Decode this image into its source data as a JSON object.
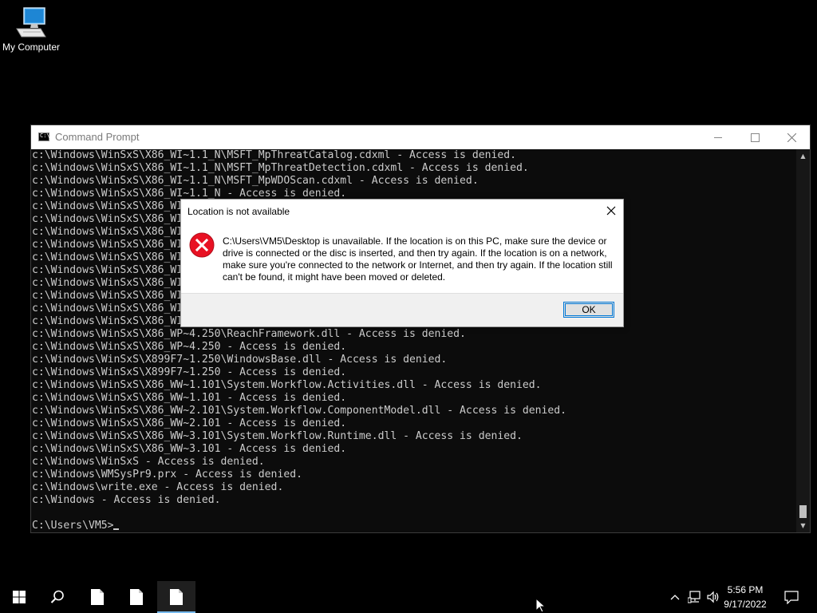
{
  "desktop": {
    "icon_label": "My Computer"
  },
  "cmd": {
    "title": "Command Prompt",
    "lines": [
      "c:\\Windows\\WinSxS\\X86_WI~1.1_N\\MSFT_MpThreatCatalog.cdxml - Access is denied.",
      "c:\\Windows\\WinSxS\\X86_WI~1.1_N\\MSFT_MpThreatDetection.cdxml - Access is denied.",
      "c:\\Windows\\WinSxS\\X86_WI~1.1_N\\MSFT_MpWDOScan.cdxml - Access is denied.",
      "c:\\Windows\\WinSxS\\X86_WI~1.1_N - Access is denied.",
      "c:\\Windows\\WinSxS\\X86_WI",
      "c:\\Windows\\WinSxS\\X86_WI",
      "c:\\Windows\\WinSxS\\X86_WI",
      "c:\\Windows\\WinSxS\\X86_WI",
      "c:\\Windows\\WinSxS\\X86_WI",
      "c:\\Windows\\WinSxS\\X86_WI",
      "c:\\Windows\\WinSxS\\X86_WI",
      "c:\\Windows\\WinSxS\\X86_WI",
      "c:\\Windows\\WinSxS\\X86_WI",
      "c:\\Windows\\WinSxS\\X86_WI",
      "c:\\Windows\\WinSxS\\X86_WP~4.250\\ReachFramework.dll - Access is denied.",
      "c:\\Windows\\WinSxS\\X86_WP~4.250 - Access is denied.",
      "c:\\Windows\\WinSxS\\X899F7~1.250\\WindowsBase.dll - Access is denied.",
      "c:\\Windows\\WinSxS\\X899F7~1.250 - Access is denied.",
      "c:\\Windows\\WinSxS\\X86_WW~1.101\\System.Workflow.Activities.dll - Access is denied.",
      "c:\\Windows\\WinSxS\\X86_WW~1.101 - Access is denied.",
      "c:\\Windows\\WinSxS\\X86_WW~2.101\\System.Workflow.ComponentModel.dll - Access is denied.",
      "c:\\Windows\\WinSxS\\X86_WW~2.101 - Access is denied.",
      "c:\\Windows\\WinSxS\\X86_WW~3.101\\System.Workflow.Runtime.dll - Access is denied.",
      "c:\\Windows\\WinSxS\\X86_WW~3.101 - Access is denied.",
      "c:\\Windows\\WinSxS - Access is denied.",
      "c:\\Windows\\WMSysPr9.prx - Access is denied.",
      "c:\\Windows\\write.exe - Access is denied.",
      "c:\\Windows - Access is denied.",
      ""
    ],
    "prompt": "C:\\Users\\VM5>"
  },
  "dialog": {
    "title": "Location is not available",
    "message": "C:\\Users\\VM5\\Desktop is unavailable. If the location is on this PC, make sure the device or drive is connected or the disc is inserted, and then try again. If the location is on a network, make sure you're connected to the network or Internet, and then try again. If the location still can't be found, it might have been moved or deleted.",
    "ok_label": "OK"
  },
  "taskbar": {
    "time": "5:56 PM",
    "date": "9/17/2022",
    "pinned": [
      "file-icon",
      "file-icon",
      "file-icon"
    ]
  },
  "colors": {
    "error_red": "#e81123",
    "accent": "#0078d7",
    "taskbar_active": "#76b9ed"
  }
}
